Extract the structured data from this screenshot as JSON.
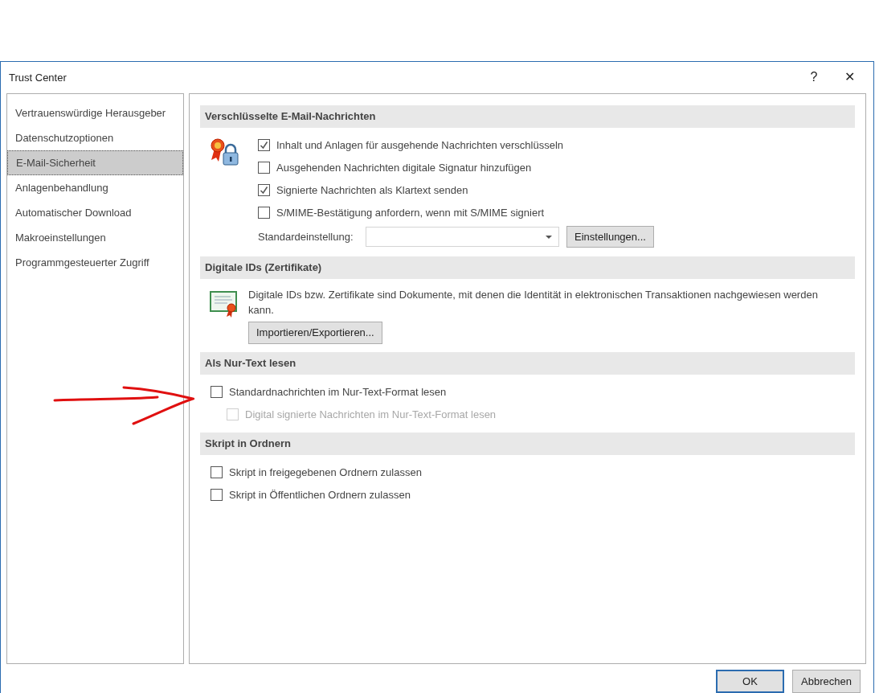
{
  "window": {
    "title": "Trust Center"
  },
  "title_buttons": [
    "?",
    "✕"
  ],
  "sidebar": {
    "items": [
      {
        "label": "Vertrauenswürdige Herausgeber",
        "selected": false
      },
      {
        "label": "Datenschutzoptionen",
        "selected": false
      },
      {
        "label": "E-Mail-Sicherheit",
        "selected": true
      },
      {
        "label": "Anlagenbehandlung",
        "selected": false
      },
      {
        "label": "Automatischer Download",
        "selected": false
      },
      {
        "label": "Makroeinstellungen",
        "selected": false
      },
      {
        "label": "Programmgesteuerter Zugriff",
        "selected": false
      }
    ]
  },
  "sections": [
    {
      "title": "Verschlüsselte E-Mail-Nachrichten",
      "items": [
        {
          "kind": "checkbox",
          "label": "Inhalt und Anlagen für ausgehende Nachrichten verschlüsseln",
          "checked": true,
          "disabled": false
        },
        {
          "kind": "checkbox",
          "label": "Ausgehenden Nachrichten digitale Signatur hinzufügen",
          "checked": false,
          "disabled": false
        },
        {
          "kind": "checkbox",
          "label": "Signierte Nachrichten als Klartext senden",
          "checked": true,
          "disabled": false
        },
        {
          "kind": "checkbox",
          "label": "S/MIME-Bestätigung anfordern, wenn mit S/MIME signiert",
          "checked": false,
          "disabled": false
        },
        {
          "kind": "dropdown",
          "label": "Standardeinstellung:",
          "button": "Einstellungen..."
        }
      ]
    },
    {
      "title": "Digitale IDs (Zertifikate)",
      "items": [
        {
          "kind": "text",
          "text": "Digitale IDs bzw. Zertifikate sind Dokumente, mit denen die Identität in elektronischen Transaktionen nachgewiesen werden kann."
        },
        {
          "kind": "button",
          "label": "Importieren/Exportieren..."
        }
      ]
    },
    {
      "title": "Als Nur-Text lesen",
      "items": [
        {
          "kind": "checkbox",
          "label": "Standardnachrichten im Nur-Text-Format lesen",
          "checked": false,
          "disabled": false,
          "children": [
            {
              "kind": "checkbox",
              "label": "Digital signierte Nachrichten im Nur-Text-Format lesen",
              "checked": false,
              "disabled": true
            }
          ]
        }
      ]
    },
    {
      "title": "Skript in Ordnern",
      "items": [
        {
          "kind": "checkbox",
          "label": "Skript in freigegebenen Ordnern zulassen",
          "checked": false,
          "disabled": false
        },
        {
          "kind": "checkbox",
          "label": "Skript in Öffentlichen Ordnern zulassen",
          "checked": false,
          "disabled": false
        }
      ]
    }
  ],
  "footer_buttons": [
    {
      "label": "OK",
      "default": true
    },
    {
      "label": "Abbrechen",
      "default": false
    }
  ]
}
